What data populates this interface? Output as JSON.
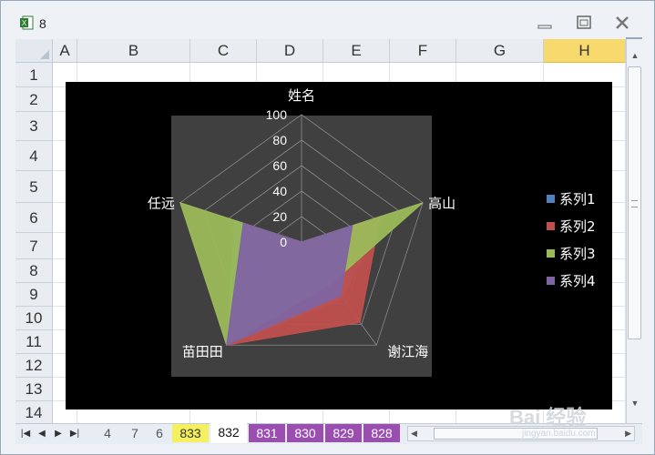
{
  "window": {
    "title": "8"
  },
  "columns": [
    "A",
    "B",
    "C",
    "D",
    "E",
    "F",
    "G",
    "H"
  ],
  "rows": [
    "1",
    "2",
    "3",
    "4",
    "5",
    "6",
    "7",
    "8",
    "9",
    "10",
    "11",
    "12",
    "13",
    "14"
  ],
  "sheet_tabs": [
    "4",
    "7",
    "6",
    "833",
    "832",
    "831",
    "830",
    "829",
    "828"
  ],
  "colors": {
    "series1": "#4f81bd",
    "series2": "#c0504d",
    "series3": "#9bbb59",
    "series4": "#8064a2",
    "plot_area": "#404040",
    "chart_bg": "#000000"
  },
  "watermark": {
    "text": "Bai 经验",
    "sub": "jingyan.baidu.com"
  },
  "chart_data": {
    "type": "radar",
    "categories": [
      "姓名",
      "高山",
      "谢江海",
      "苗田田",
      "任远"
    ],
    "ylim": [
      0,
      100
    ],
    "ticks": [
      "0",
      "20",
      "40",
      "60",
      "80",
      "100"
    ],
    "legend_position": "right",
    "series": [
      {
        "name": "系列1",
        "values": [
          0,
          65,
          55,
          100,
          55
        ]
      },
      {
        "name": "系列2",
        "values": [
          0,
          65,
          78,
          100,
          45
        ]
      },
      {
        "name": "系列3",
        "values": [
          0,
          100,
          40,
          100,
          100
        ]
      },
      {
        "name": "系列4",
        "values": [
          0,
          42,
          52,
          100,
          48
        ]
      }
    ]
  }
}
